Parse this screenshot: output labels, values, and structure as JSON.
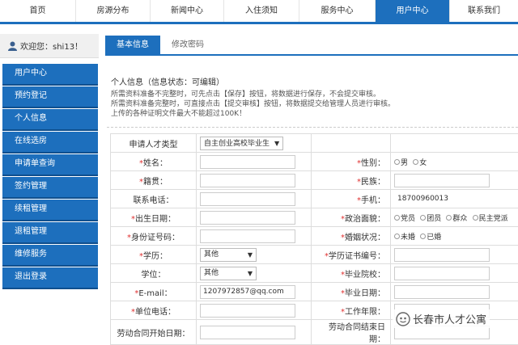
{
  "topnav": [
    "首页",
    "房源分布",
    "新闻中心",
    "入住须知",
    "服务中心",
    "用户中心",
    "联系我们"
  ],
  "welcome": "欢迎您：shi13！",
  "sidebar": [
    "用户中心",
    "预约登记",
    "个人信息",
    "在线选房",
    "申请单查询",
    "签约管理",
    "续租管理",
    "退租管理",
    "维修服务",
    "退出登录"
  ],
  "tabs": [
    "基本信息",
    "修改密码"
  ],
  "section_title": "个人信息（信息状态：可编辑）",
  "notes": [
    "所需资料准备不完整时，可先点击【保存】按钮，将数据进行保存，不会提交审核。",
    "所需资料准备完整时，可直接点击【提交审核】按钮，将数据提交给管理人员进行审核。",
    "上传的各种证明文件最大不能超过100K！"
  ],
  "form": {
    "type_label": "申请人才类型",
    "type_value": "自主创业高校毕业生",
    "name_label": "姓名：",
    "gender_label": "性别：",
    "gender_options": [
      "男",
      "女"
    ],
    "native_label": "籍贯：",
    "ethnic_label": "民族：",
    "phone_label": "联系电话：",
    "mobile_label": "手机：",
    "mobile_value": "18700960013",
    "birth_label": "出生日期：",
    "political_label": "政治面貌：",
    "political_options": [
      "党员",
      "团员",
      "群众",
      "民主党派"
    ],
    "id_label": "身份证号码：",
    "marital_label": "婚姻状况：",
    "marital_options": [
      "未婚",
      "已婚"
    ],
    "edu_label": "学历：",
    "edu_value": "其他",
    "cert_label": "学历证书编号：",
    "degree_label": "学位：",
    "degree_value": "其他",
    "school_label": "毕业院校：",
    "email_label": "E-mail：",
    "email_value": "1207972857@qq.com",
    "grad_label": "毕业日期：",
    "work_phone_label": "单位电话：",
    "work_years_label": "工作年限：",
    "contract_start_label": "劳动合同开始日期：",
    "contract_end_label": "劳动合同结束日期："
  },
  "watermark": "长春市人才公寓"
}
